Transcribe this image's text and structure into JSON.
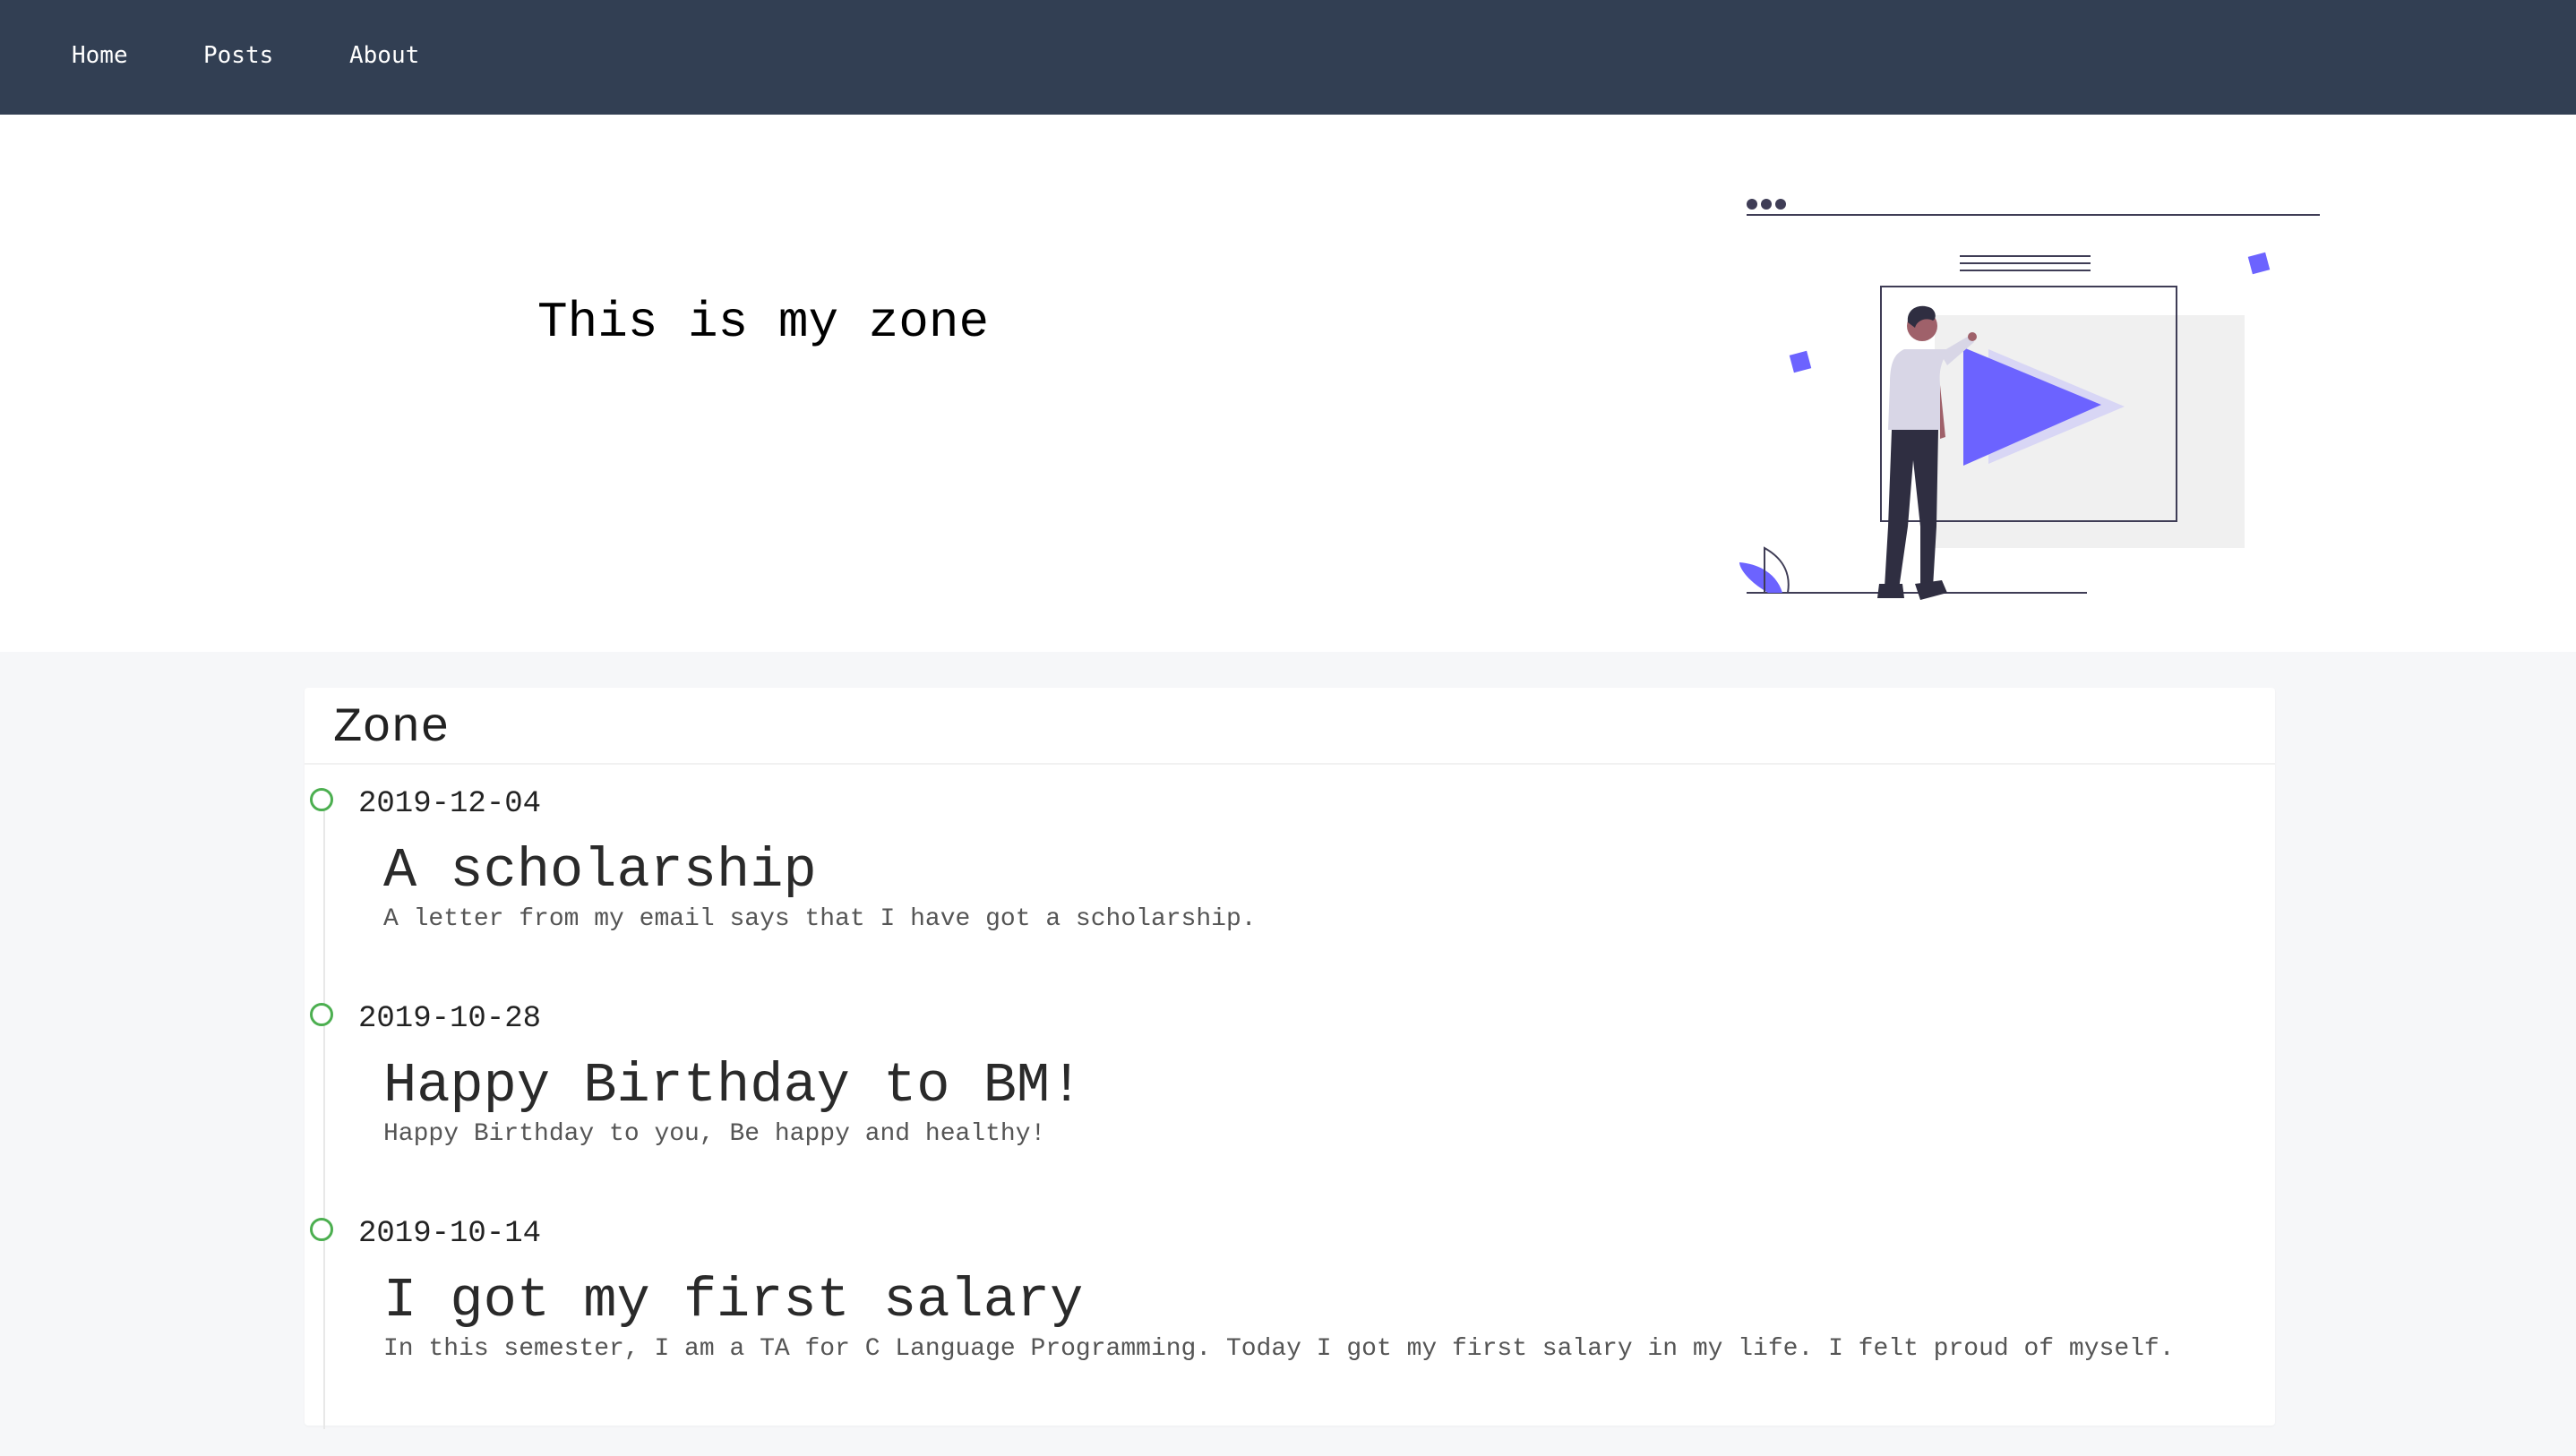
{
  "nav": {
    "items": [
      {
        "label": "Home"
      },
      {
        "label": "Posts"
      },
      {
        "label": "About"
      }
    ]
  },
  "hero": {
    "title": "This is my zone",
    "illustration_icon": "person-with-video-play-illustration"
  },
  "zone": {
    "title": "Zone",
    "entries": [
      {
        "date": "2019-12-04",
        "title": "A scholarship",
        "summary": "A letter from my email says that I have got a scholarship."
      },
      {
        "date": "2019-10-28",
        "title": "Happy Birthday to BM!",
        "summary": "Happy Birthday to you, Be happy and healthy!"
      },
      {
        "date": "2019-10-14",
        "title": "I got my first salary",
        "summary": "In this semester, I am a TA for C Language Programming. Today I got my first salary in my life. I felt proud of myself."
      }
    ]
  },
  "colors": {
    "navbar": "#323f53",
    "accent": "#6c63ff",
    "timeline_dot": "#4caf50",
    "page_background": "#f6f7f9"
  }
}
